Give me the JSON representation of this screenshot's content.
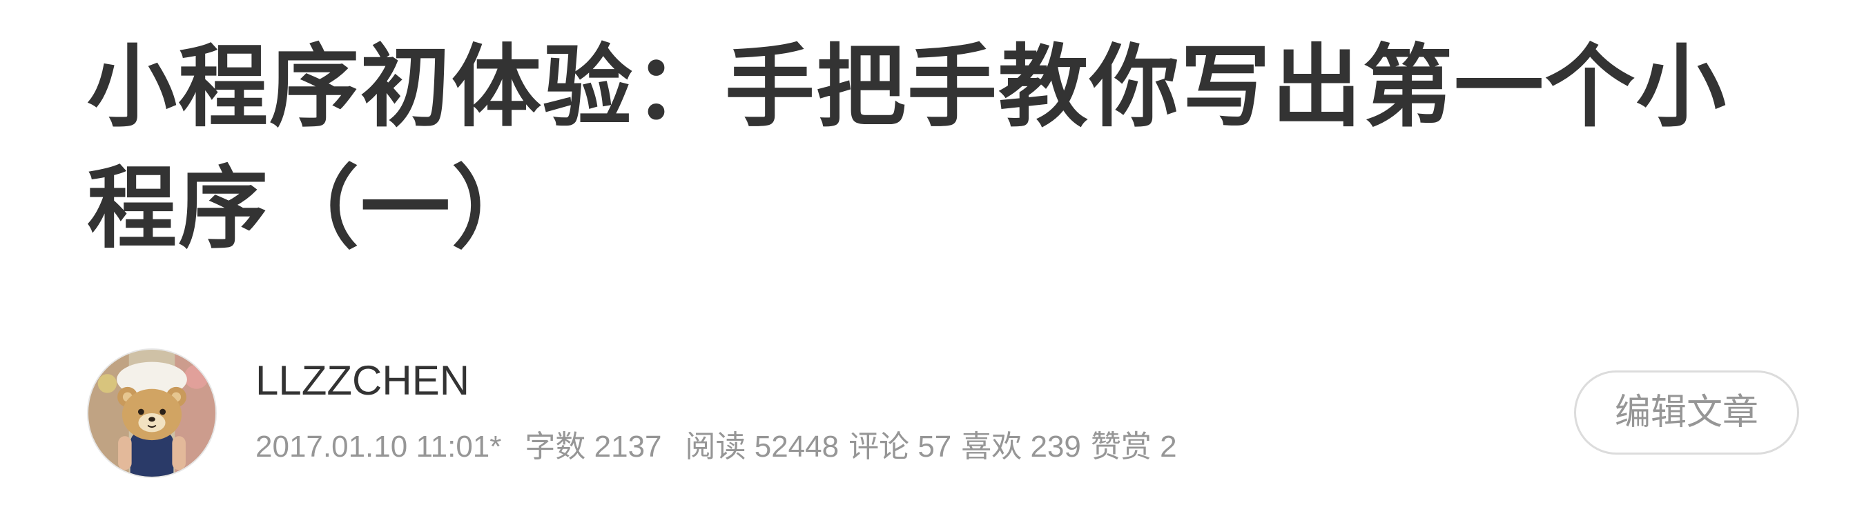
{
  "article": {
    "title": "小程序初体验：手把手教你写出第一个小程序（一）"
  },
  "author": {
    "name": "LLZZCHEN",
    "avatar_icon": "bear-mask-avatar"
  },
  "meta": {
    "publish_time": "2017.01.10 11:01*",
    "word_count": "字数 2137",
    "views": "阅读 52448",
    "comments": "评论 57",
    "likes": "喜欢 239",
    "rewards": "赞赏 2"
  },
  "actions": {
    "edit_label": "编辑文章"
  },
  "colors": {
    "title": "#333333",
    "meta": "#969696",
    "button_border": "#dcdcdc"
  }
}
